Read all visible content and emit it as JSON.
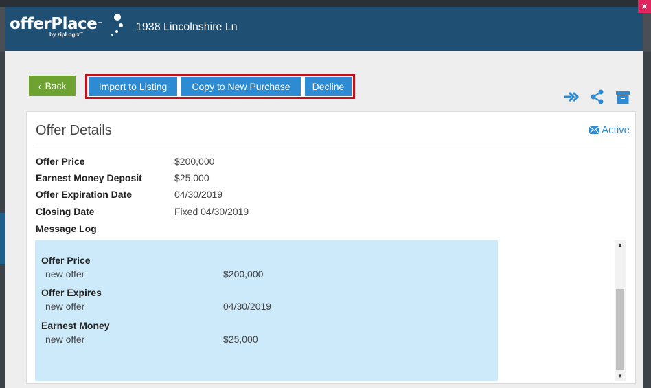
{
  "header": {
    "logo_main": "offerPlace",
    "logo_tm": "™",
    "logo_sub": "by zipLogix",
    "logo_sub_tm": "™",
    "title": "1938 Lincolnshire Ln",
    "close_label": "×"
  },
  "toolbar": {
    "back_label": "Back",
    "import_label": "Import to Listing",
    "copy_label": "Copy to New Purchase",
    "decline_label": "Decline",
    "icons": [
      "forward-icon",
      "share-icon",
      "archive-icon"
    ]
  },
  "panel": {
    "title": "Offer Details",
    "status": "Active",
    "details": [
      {
        "label": "Offer Price",
        "value": "$200,000"
      },
      {
        "label": "Earnest Money Deposit",
        "value": "$25,000"
      },
      {
        "label": "Offer Expiration Date",
        "value": "04/30/2019"
      },
      {
        "label": "Closing Date",
        "value": "Fixed 04/30/2019"
      },
      {
        "label": "Message Log",
        "value": ""
      }
    ],
    "log": [
      {
        "heading": "Offer Price",
        "sub": "new offer",
        "value": "$200,000"
      },
      {
        "heading": "Offer Expires",
        "sub": "new offer",
        "value": "04/30/2019"
      },
      {
        "heading": "Earnest Money",
        "sub": "new offer",
        "value": "$25,000"
      }
    ]
  },
  "colors": {
    "header_bg": "#1f4f73",
    "accent_blue": "#2d8bd3",
    "back_green": "#6ea331",
    "highlight_red": "#c0101c",
    "log_bg": "#cdeafa"
  }
}
